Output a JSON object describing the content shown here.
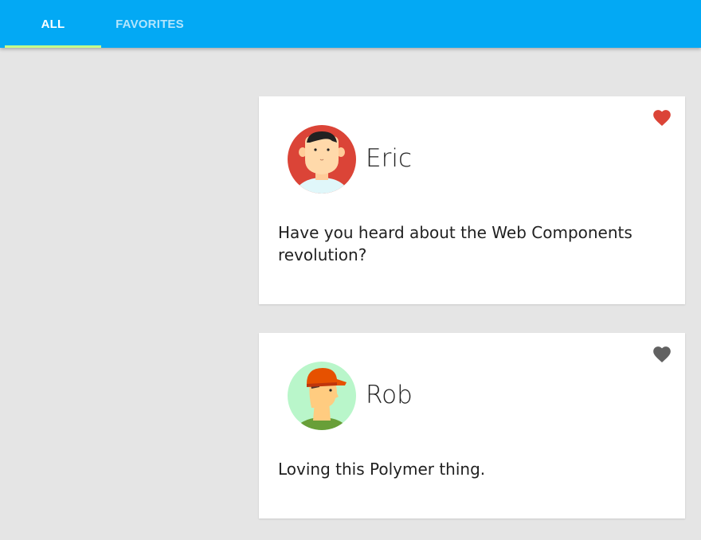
{
  "tabs": [
    {
      "label": "ALL",
      "selected": true
    },
    {
      "label": "FAVORITES",
      "selected": false
    }
  ],
  "colors": {
    "toolbar": "#03a9f4",
    "tab_indicator": "#c6ff8a",
    "favorite_on": "#db4437",
    "favorite_off": "#616161",
    "background": "#e5e5e5"
  },
  "posts": [
    {
      "username": "Eric",
      "text": "Have you heard about the Web Components revolution?",
      "favorite": true,
      "avatar_icon": "avatar-eric"
    },
    {
      "username": "Rob",
      "text": "Loving this Polymer thing.",
      "favorite": false,
      "avatar_icon": "avatar-rob"
    }
  ]
}
